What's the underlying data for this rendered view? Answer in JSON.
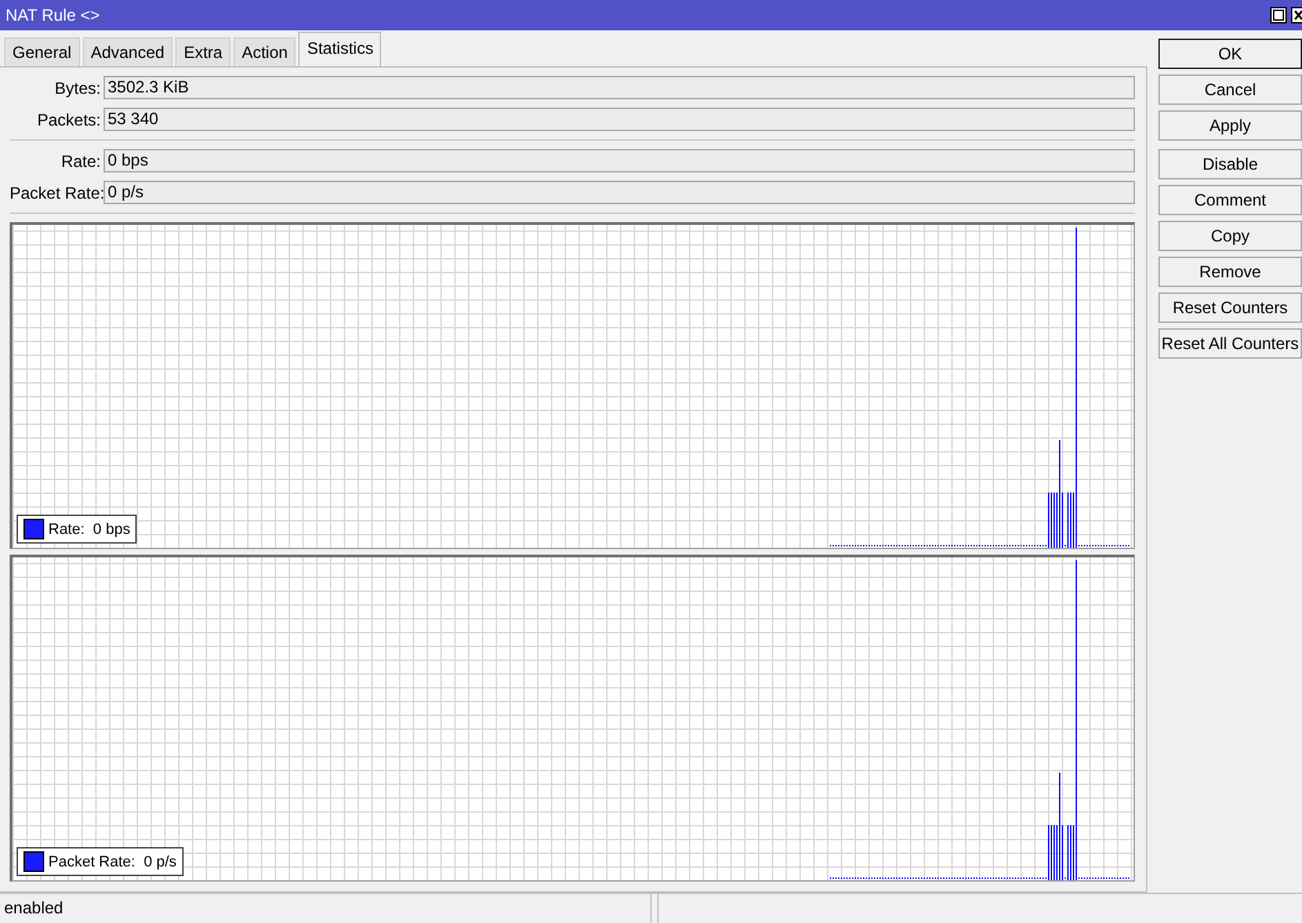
{
  "window": {
    "title": "NAT Rule <>"
  },
  "tabs": [
    {
      "label": "General",
      "selected": false
    },
    {
      "label": "Advanced",
      "selected": false
    },
    {
      "label": "Extra",
      "selected": false
    },
    {
      "label": "Action",
      "selected": false
    },
    {
      "label": "Statistics",
      "selected": true
    }
  ],
  "field_groups": [
    [
      {
        "label": "Bytes:",
        "value": "3502.3 KiB"
      },
      {
        "label": "Packets:",
        "value": "53 340"
      }
    ],
    [
      {
        "label": "Rate:",
        "value": "0 bps"
      },
      {
        "label": "Packet Rate:",
        "value": "0 p/s"
      }
    ]
  ],
  "graphs": [
    {
      "legend": "Rate:  0 bps"
    },
    {
      "legend": "Packet Rate:  0 p/s"
    }
  ],
  "button_groups": [
    [
      {
        "label": "OK",
        "default": true
      },
      {
        "label": "Cancel",
        "default": false
      },
      {
        "label": "Apply",
        "default": false
      }
    ],
    [
      {
        "label": "Disable",
        "default": false
      },
      {
        "label": "Comment",
        "default": false
      },
      {
        "label": "Copy",
        "default": false
      },
      {
        "label": "Remove",
        "default": false
      },
      {
        "label": "Reset Counters",
        "default": false
      },
      {
        "label": "Reset All Counters",
        "default": false
      }
    ]
  ],
  "status_bar": {
    "text": "enabled"
  }
}
